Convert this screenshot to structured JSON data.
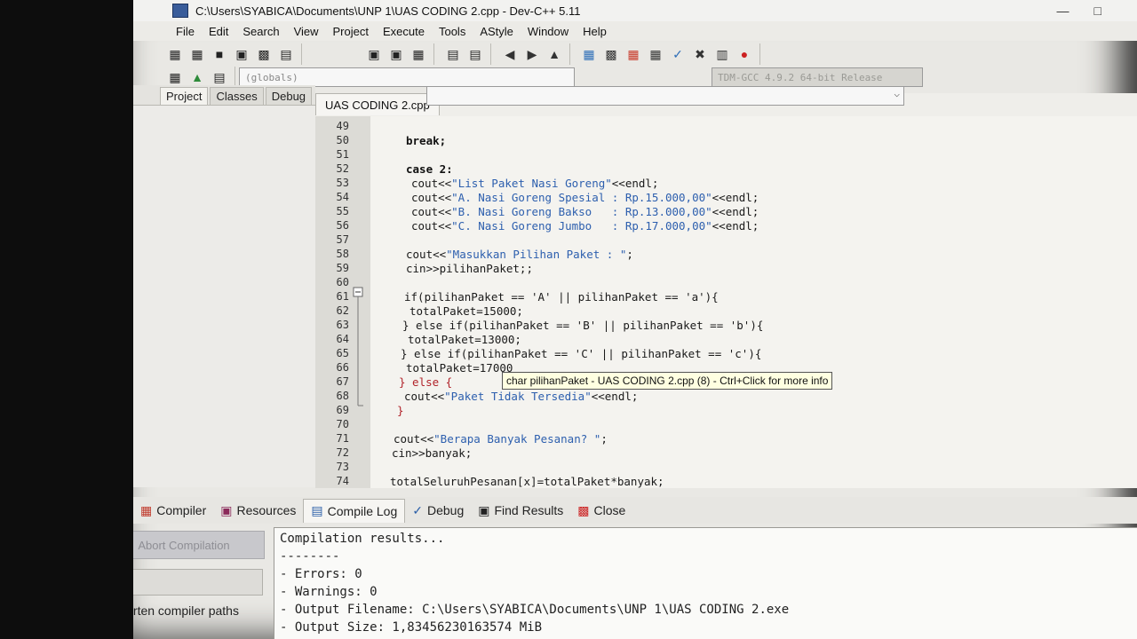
{
  "window": {
    "title": "C:\\Users\\SYABICA\\Documents\\UNP 1\\UAS CODING 2.cpp - Dev-C++ 5.11"
  },
  "menu": [
    "File",
    "Edit",
    "Search",
    "View",
    "Project",
    "Execute",
    "Tools",
    "AStyle",
    "Window",
    "Help"
  ],
  "toolbar": {
    "scope_combo": "(globals)",
    "compiler_combo": "TDM-GCC 4.9.2 64-bit Release"
  },
  "left_panel": {
    "tabs": [
      "Project",
      "Classes",
      "Debug"
    ]
  },
  "editor": {
    "tab_label": "UAS CODING 2.cpp",
    "line_numbers": [
      "49",
      "50",
      "51",
      "52",
      "53",
      "54",
      "55",
      "56",
      "57",
      "58",
      "59",
      "60",
      "61",
      "62",
      "63",
      "64",
      "65",
      "66",
      "67",
      "68",
      "69",
      "70",
      "71",
      "72",
      "73",
      "74"
    ],
    "tooltip": "char pilihanPaket - UAS CODING 2.cpp (8) - Ctrl+Click for more info",
    "code": {
      "l50": "break;",
      "l52": "case 2:",
      "l53a": "cout<<",
      "l53b": "\"List Paket Nasi Goreng\"",
      "l53c": "<<endl;",
      "l54a": "cout<<",
      "l54b": "\"A. Nasi Goreng Spesial : Rp.15.000,00\"",
      "l54c": "<<endl;",
      "l55a": "cout<<",
      "l55b": "\"B. Nasi Goreng Bakso   : Rp.13.000,00\"",
      "l55c": "<<endl;",
      "l56a": "cout<<",
      "l56b": "\"C. Nasi Goreng Jumbo   : Rp.17.000,00\"",
      "l56c": "<<endl;",
      "l58a": "cout<<",
      "l58b": "\"Masukkan Pilihan Paket : \"",
      "l58c": ";",
      "l59": "cin>>pilihanPaket;;",
      "l61": "if(pilihanPaket == 'A' || pilihanPaket == 'a'){",
      "l62": "totalPaket=15000;",
      "l63": "} else if(pilihanPaket == 'B' || pilihanPaket == 'b'){",
      "l64": "totalPaket=13000;",
      "l65": "} else if(pilihanPaket == 'C' || pilihanPaket == 'c'){",
      "l66": "totalPaket=17000",
      "l67": "} else {",
      "l68a": "cout<<",
      "l68b": "\"Paket Tidak Tersedia\"",
      "l68c": "<<endl;",
      "l69": "}",
      "l71a": "cout<<",
      "l71b": "\"Berapa Banyak Pesanan? \"",
      "l71c": ";",
      "l72": "cin>>banyak;",
      "l74": "totalSeluruhPesanan[x]=totalPaket*banyak;"
    }
  },
  "bottom_panel": {
    "tabs": [
      "Compiler",
      "Resources",
      "Compile Log",
      "Debug",
      "Find Results",
      "Close"
    ],
    "active_tab": "Compile Log",
    "abort_button": "Abort Compilation",
    "shorten_paths_label": "Shorten compiler paths",
    "log_lines": [
      "Compilation results...",
      "--------",
      "- Errors: 0",
      "- Warnings: 0",
      "- Output Filename: C:\\Users\\SYABICA\\Documents\\UNP 1\\UAS CODING 2.exe",
      "- Output Size: 1,83456230163574 MiB"
    ]
  }
}
